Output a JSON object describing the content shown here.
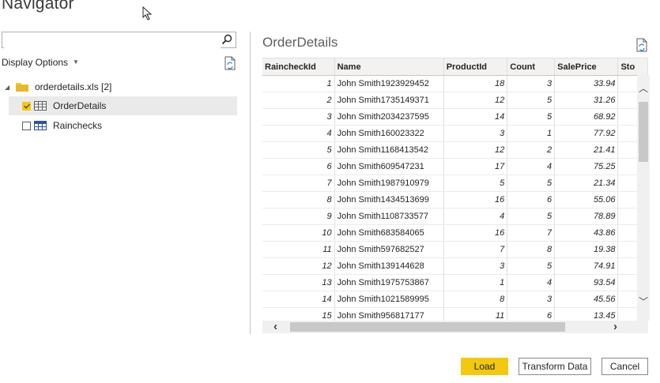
{
  "window": {
    "title": "Navigator"
  },
  "left_pane": {
    "search": {
      "value": "",
      "placeholder": ""
    },
    "display_options_label": "Display Options",
    "tree": {
      "root": {
        "label": "orderdetails.xls [2]"
      },
      "items": [
        {
          "label": "OrderDetails",
          "checked": true,
          "selected": true
        },
        {
          "label": "Rainchecks",
          "checked": false,
          "selected": false
        }
      ]
    }
  },
  "preview": {
    "title": "OrderDetails",
    "columns": [
      "RaincheckId",
      "Name",
      "ProductId",
      "Count",
      "SalePrice",
      "Sto"
    ],
    "rows": [
      [
        "1",
        "John Smith1923929452",
        "18",
        "3",
        "33.94"
      ],
      [
        "2",
        "John Smith1735149371",
        "12",
        "5",
        "31.26"
      ],
      [
        "3",
        "John Smith2034237595",
        "14",
        "5",
        "68.92"
      ],
      [
        "4",
        "John Smith160023322",
        "3",
        "1",
        "77.92"
      ],
      [
        "5",
        "John Smith1168413542",
        "12",
        "2",
        "21.41"
      ],
      [
        "6",
        "John Smith609547231",
        "17",
        "4",
        "75.25"
      ],
      [
        "7",
        "John Smith1987910979",
        "5",
        "5",
        "21.34"
      ],
      [
        "8",
        "John Smith1434513699",
        "16",
        "6",
        "55.06"
      ],
      [
        "9",
        "John Smith1108733577",
        "4",
        "5",
        "78.89"
      ],
      [
        "10",
        "John Smith683584065",
        "16",
        "7",
        "43.86"
      ],
      [
        "11",
        "John Smith597682527",
        "7",
        "8",
        "19.38"
      ],
      [
        "12",
        "John Smith139144628",
        "3",
        "5",
        "74.91"
      ],
      [
        "13",
        "John Smith1975753867",
        "1",
        "4",
        "93.54"
      ],
      [
        "14",
        "John Smith1021589995",
        "8",
        "3",
        "45.56"
      ],
      [
        "15",
        "John Smith956817177",
        "11",
        "6",
        "13.45"
      ]
    ]
  },
  "buttons": {
    "load": "Load",
    "transform": "Transform Data",
    "cancel": "Cancel"
  },
  "colors": {
    "accent": "#f2c811",
    "selected_row": "#eaeaea"
  }
}
